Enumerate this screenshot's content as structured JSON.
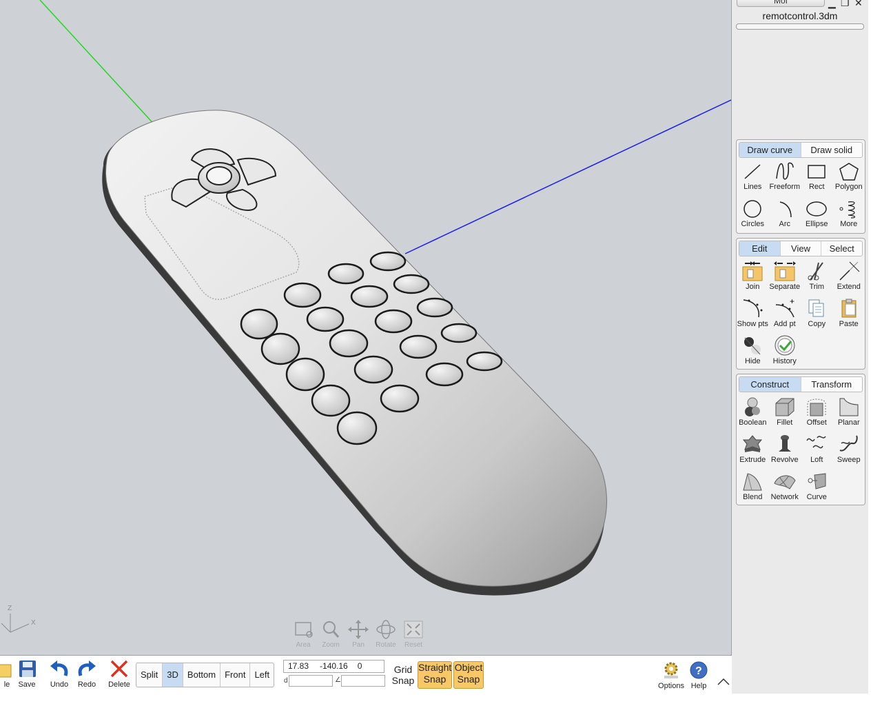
{
  "app": {
    "name": "MoI",
    "document_title": "remotcontrol.3dm"
  },
  "viewport": {
    "axis_x": "X",
    "axis_z": "Z",
    "nav_tools": [
      {
        "label": "Area",
        "icon": "area-zoom-icon"
      },
      {
        "label": "Zoom",
        "icon": "magnifier-icon"
      },
      {
        "label": "Pan",
        "icon": "pan-arrows-icon"
      },
      {
        "label": "Rotate",
        "icon": "rotate-icon"
      },
      {
        "label": "Reset",
        "icon": "reset-view-icon"
      }
    ]
  },
  "palettes": {
    "draw": {
      "tabs": [
        "Draw curve",
        "Draw solid"
      ],
      "active_tab": "Draw curve",
      "tools": [
        {
          "label": "Lines",
          "icon": "line-icon"
        },
        {
          "label": "Freeform",
          "icon": "freeform-curve-icon"
        },
        {
          "label": "Rect",
          "icon": "rectangle-icon"
        },
        {
          "label": "Polygon",
          "icon": "polygon-icon"
        },
        {
          "label": "Circles",
          "icon": "circle-icon"
        },
        {
          "label": "Arc",
          "icon": "arc-icon"
        },
        {
          "label": "Ellipse",
          "icon": "ellipse-icon"
        },
        {
          "label": "More",
          "icon": "helix-icon"
        }
      ]
    },
    "edit": {
      "tabs": [
        "Edit",
        "View",
        "Select"
      ],
      "active_tab": "Edit",
      "tools": [
        {
          "label": "Join",
          "icon": "join-icon"
        },
        {
          "label": "Separate",
          "icon": "separate-icon"
        },
        {
          "label": "Trim",
          "icon": "scissors-icon"
        },
        {
          "label": "Extend",
          "icon": "extend-icon"
        },
        {
          "label": "Show pts",
          "icon": "show-points-icon"
        },
        {
          "label": "Add pt",
          "icon": "add-point-icon"
        },
        {
          "label": "Copy",
          "icon": "copy-icon"
        },
        {
          "label": "Paste",
          "icon": "paste-icon"
        },
        {
          "label": "Hide",
          "icon": "hide-icon"
        },
        {
          "label": "History",
          "icon": "history-icon"
        }
      ]
    },
    "construct": {
      "tabs": [
        "Construct",
        "Transform"
      ],
      "active_tab": "Construct",
      "tools": [
        {
          "label": "Boolean",
          "icon": "boolean-icon"
        },
        {
          "label": "Fillet",
          "icon": "fillet-icon"
        },
        {
          "label": "Offset",
          "icon": "offset-icon"
        },
        {
          "label": "Planar",
          "icon": "planar-icon"
        },
        {
          "label": "Extrude",
          "icon": "extrude-icon"
        },
        {
          "label": "Revolve",
          "icon": "revolve-icon"
        },
        {
          "label": "Loft",
          "icon": "loft-icon"
        },
        {
          "label": "Sweep",
          "icon": "sweep-icon"
        },
        {
          "label": "Blend",
          "icon": "blend-icon"
        },
        {
          "label": "Network",
          "icon": "network-icon"
        },
        {
          "label": "Curve",
          "icon": "curve-icon"
        }
      ]
    }
  },
  "bottombar": {
    "file_label": "le",
    "save_label": "Save",
    "undo_label": "Undo",
    "redo_label": "Redo",
    "delete_label": "Delete",
    "views": [
      "Split",
      "3D",
      "Bottom",
      "Front",
      "Left"
    ],
    "active_view": "3D",
    "coords": {
      "x": "17.83",
      "y": "-140.16",
      "z": "0"
    },
    "distance_label": "d",
    "angle_label": "∠",
    "grid_snap": {
      "line1": "Grid",
      "line2": "Snap"
    },
    "straight_snap": {
      "line1": "Straight",
      "line2": "Snap"
    },
    "object_snap": {
      "line1": "Object",
      "line2": "Snap"
    },
    "options_label": "Options",
    "help_label": "Help"
  },
  "colors": {
    "viewport_bg": "#ced2d6",
    "active_tab": "#c7dcf3",
    "snap_on": "#f7c768",
    "axis_y": "#22d622",
    "axis_x": "#1e1ee6"
  }
}
